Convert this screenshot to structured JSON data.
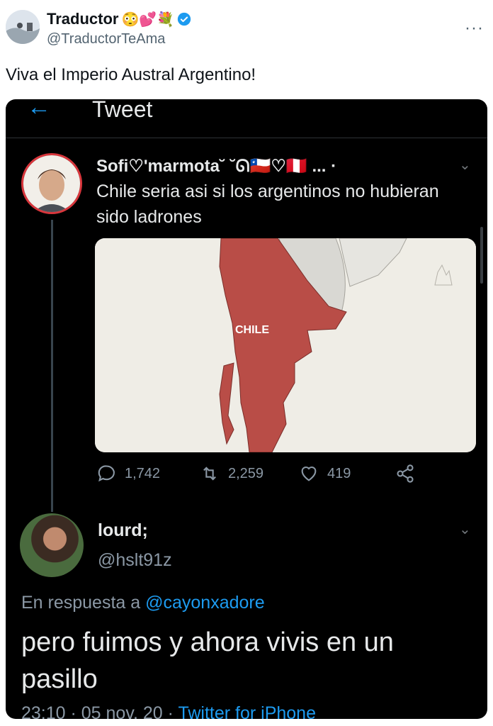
{
  "outer_tweet": {
    "name": "Traductor",
    "name_emojis": "😳💕💐",
    "handle": "@TraductorTeAma",
    "more_label": "···",
    "text": "Viva el Imperio Austral Argentino!"
  },
  "screenshot": {
    "header_title": "Tweet",
    "quoted": {
      "name": "Sofi♡'marmota˘ ˘ᘏ🇨🇱♡🇵🇪 ... ·",
      "text": "Chile seria asi si los argentinos no hubieran sido ladrones",
      "map_label": "CHILE",
      "replies": "1,742",
      "retweets": "2,259",
      "likes": "419"
    },
    "reply": {
      "name": "lourd;",
      "handle": "@hslt91z",
      "reply_prefix": "En respuesta a",
      "reply_to": "@cayonxadore",
      "text": "pero fuimos y ahora vivis en un pasillo",
      "time": "23:10 · 05 nov. 20 · ",
      "client": "Twitter for iPhone"
    }
  },
  "colors": {
    "accent": "#1d9bf0",
    "map_red": "#b94d47",
    "background_dark": "#000000"
  }
}
